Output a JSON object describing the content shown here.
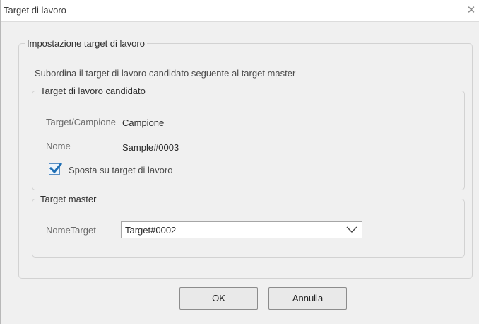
{
  "window": {
    "title": "Target di lavoro",
    "close_glyph": "✕"
  },
  "settings_group": {
    "legend": "Impostazione target di lavoro",
    "description": "Subordina il target di lavoro candidato seguente al target master"
  },
  "candidate_group": {
    "legend": "Target di lavoro candidato",
    "target_sample_label": "Target/Campione",
    "target_sample_value": "Campione",
    "name_label": "Nome",
    "name_value": "Sample#0003",
    "move_checkbox": {
      "label": "Sposta su target di lavoro",
      "checked": true
    }
  },
  "master_group": {
    "legend": "Target master",
    "target_name_label": "NomeTarget",
    "target_name_value": "Target#0002"
  },
  "buttons": {
    "ok": "OK",
    "cancel": "Annulla"
  },
  "icons": {
    "close": "close-icon",
    "check": "checkmark-icon",
    "dropdown": "chevron-down-icon"
  },
  "colors": {
    "check_accent": "#1f6fb5"
  }
}
